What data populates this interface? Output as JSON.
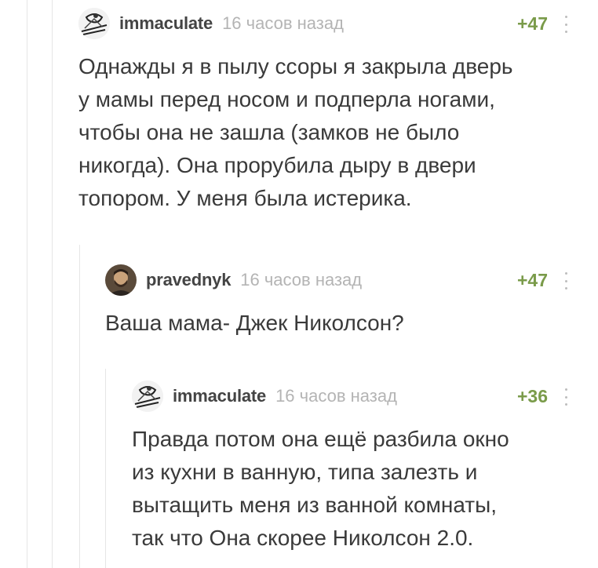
{
  "comments": [
    {
      "username": "immaculate",
      "time": "16 часов назад",
      "rating": "+47",
      "text": "Однажды я в пылу ссоры я закрыла дверь\nу мамы перед носом и подперла ногами,\nчтобы она не зашла (замков не было\nникогда). Она прорубила дыру в двери\nтопором. У меня была истерика.",
      "avatar_icon": "sketch-avatar"
    },
    {
      "username": "pravednyk",
      "time": "16 часов назад",
      "rating": "+47",
      "text": "Ваша мама- Джек Николсон?",
      "avatar_icon": "photo-avatar"
    },
    {
      "username": "immaculate",
      "time": "16 часов назад",
      "rating": "+36",
      "text": "Правда потом она ещё разбила окно\nиз кухни в ванную, типа залезть и\nвытащить меня из ванной комнаты,\nтак что Она скорее Николсон 2.0.",
      "avatar_icon": "sketch-avatar"
    }
  ],
  "colors": {
    "rating": "#7a9b4a",
    "timestamp": "#b4b4b4",
    "username": "#444444",
    "thread_line": "#e6e6e6"
  }
}
